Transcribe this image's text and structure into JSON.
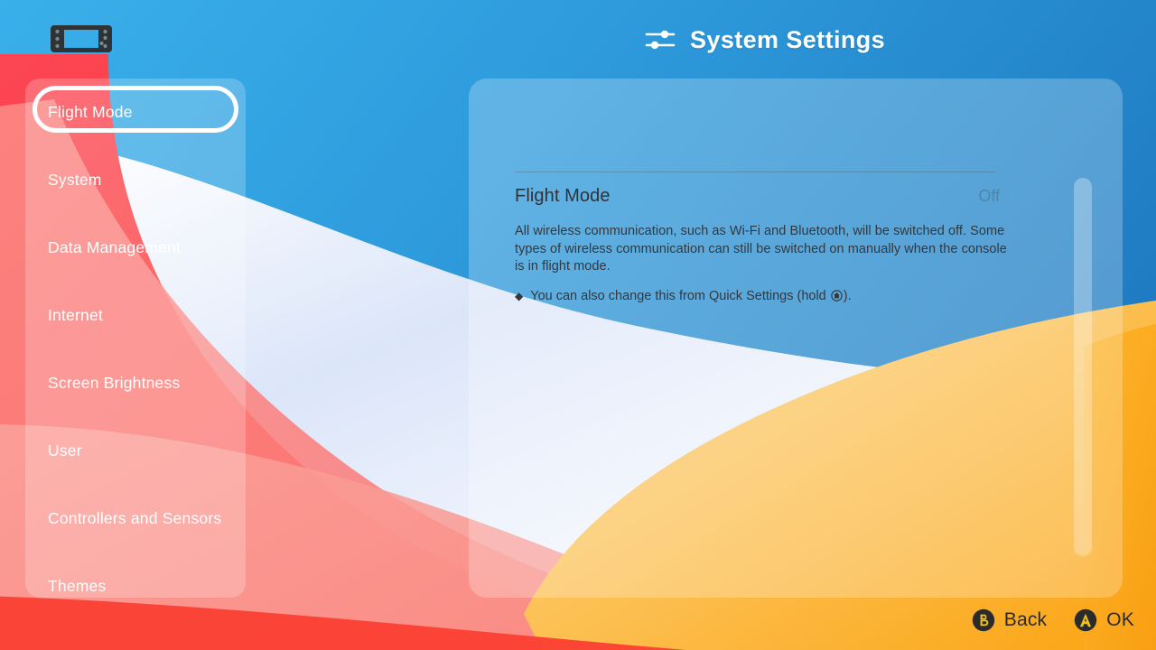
{
  "header": {
    "title": "System Settings",
    "console_icon": "switch-console-icon",
    "settings_icon": "sliders-icon"
  },
  "sidebar": {
    "selected_index": 0,
    "items": [
      {
        "label": "Flight Mode"
      },
      {
        "label": "System"
      },
      {
        "label": "Data Management"
      },
      {
        "label": "Internet"
      },
      {
        "label": "Screen Brightness"
      },
      {
        "label": "User"
      },
      {
        "label": "Controllers and Sensors"
      },
      {
        "label": "Themes"
      }
    ]
  },
  "content": {
    "setting_name": "Flight Mode",
    "setting_value": "Off",
    "description": "All wireless communication, such as Wi-Fi and Bluetooth, will be switched off. Some types of wireless communication can still be switched on manually when the console is in flight mode.",
    "note_bullet": "◆",
    "note_prefix": "You can also change this from Quick Settings (hold ",
    "note_suffix": ").",
    "note_icon": "home-button-icon"
  },
  "hints": [
    {
      "button": "B",
      "label": "Back",
      "color": "#2b2b2b",
      "letter_color": "#f0c020"
    },
    {
      "button": "A",
      "label": "OK",
      "color": "#2b2b2b",
      "letter_color": "#f0c020"
    }
  ],
  "colors": {
    "bg_blue_dark": "#2382c8",
    "bg_blue_light": "#36a9e8",
    "bg_white_band": "#eef2fb",
    "bg_red": "#f93a42",
    "bg_coral": "#fb6a63",
    "bg_orange": "#fba81f",
    "bg_yellow": "#fdc83c",
    "panel_fill": "rgba(255,255,255,0.23)",
    "selection_ring": "#ffffff",
    "text_light": "#ffffff",
    "text_dark": "#32383e"
  }
}
